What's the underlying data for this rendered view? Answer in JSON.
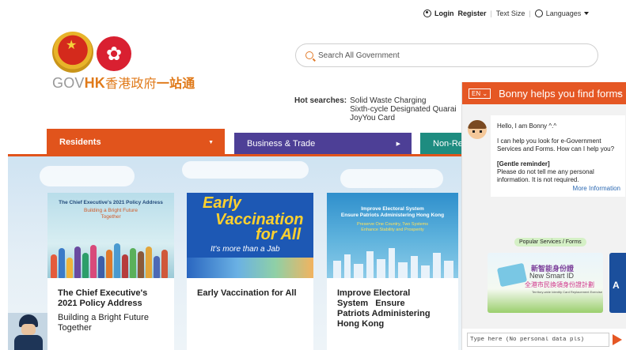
{
  "topbar": {
    "login": "Login",
    "register": "Register",
    "text_size": "Text Size",
    "languages": "Languages"
  },
  "logo": {
    "gov": "GOV",
    "hk": "HK",
    "zh_text": "香港政府",
    "zh_onestop": "一站通"
  },
  "search": {
    "placeholder": "Search All Government"
  },
  "hot_searches": {
    "label": "Hot searches:",
    "items": [
      "Solid Waste Charging",
      "Sixth-cycle Designated Quarai",
      "JoyYou Card"
    ]
  },
  "tabs": {
    "residents": "Residents",
    "business": "Business & Trade",
    "non_residents": "Non-Re"
  },
  "cards": [
    {
      "img_title": "The Chief Executive's 2021 Policy Address",
      "img_sub1": "Building a Bright Future",
      "img_sub2": "Together",
      "title_line1": "The Chief Executive's",
      "title_line2": "2021 Policy Address",
      "subtitle_line1": "Building a Bright Future",
      "subtitle_line2": "Together"
    },
    {
      "img_line1": "Early",
      "img_line2": "Vaccination",
      "img_line3": "for All",
      "img_sub": "It's more than a Jab",
      "title": "Early Vaccination for All"
    },
    {
      "img_title1": "Improve Electoral System",
      "img_title2": "Ensure Patriots Administering Hong Kong",
      "img_sub1": "Preserve One Country, Two Systems",
      "img_sub2": "Enhance Stability and Prosperity",
      "title_line1": "Improve Electoral",
      "title_line2": "System   Ensure",
      "title_line3": "Patriots Administering",
      "title_line4": "Hong Kong"
    }
  ],
  "chat": {
    "lang_button": "EN",
    "title": "Bonny helps you find forms",
    "greeting": "Hello, I am Bonny ^.^",
    "intro": "I can help you look for e-Government Services and Forms. How can I help you?",
    "reminder_title": "[Gentle reminder]",
    "reminder_text": "Please do not tell me any personal information. It is not required.",
    "more_info": "More Information",
    "popular": "Popular Services / Forms",
    "service_zh1": "新智能身份證",
    "service_en": "New Smart ID",
    "service_zh2": "全港市民換領身份證計劃",
    "service_small": "Territory-wide Identity Card Replacement Exercise",
    "service2_letter": "A",
    "input_placeholder": "Type here (No personal data pls)"
  }
}
